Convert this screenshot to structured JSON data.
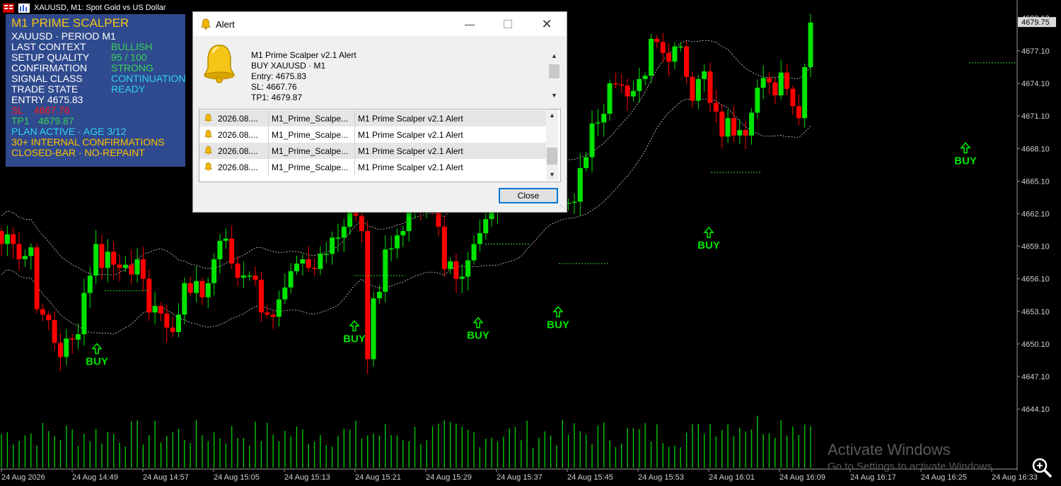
{
  "window": {
    "title": "XAUUSD, M1:  Spot Gold vs US Dollar",
    "current_price_tag": "4679.75",
    "top_price_label": "4680.13"
  },
  "panel": {
    "title": "M1 PRIME SCALPER",
    "subtitle": "XAUUSD · PERIOD M1",
    "rows": [
      {
        "label": "LAST CONTEXT",
        "value": "BULLISH"
      },
      {
        "label": "SETUP QUALITY",
        "value": "95 / 100"
      },
      {
        "label": "CONFIRMATION",
        "value": "STRONG"
      },
      {
        "label": "SIGNAL CLASS",
        "value": "CONTINUATION"
      },
      {
        "label": "TRADE STATE",
        "value": "READY"
      }
    ],
    "entry": "ENTRY 4675.83",
    "sl_label": "SL",
    "sl_value": "4667.76",
    "tp_label": "TP1",
    "tp_value": "4679.87",
    "plan": "PLAN ACTIVE · AGE 3/12",
    "confirmations": "30+ INTERNAL CONFIRMATIONS",
    "closed_bar": "CLOSED-BAR · NO-REPAINT",
    "colors": {
      "bg": "#2f4a8e",
      "title": "#f5c518",
      "green": "#39d353",
      "cyan": "#2fd4f0",
      "red": "#ff1a1a",
      "orange": "#ffc000"
    }
  },
  "alert": {
    "title": "Alert",
    "message": [
      "M1 Prime Scalper v2.1 Alert",
      "BUY XAUUSD · M1",
      "Entry: 4675.83",
      "SL: 4667.76",
      "TP1: 4679.87"
    ],
    "rows": [
      {
        "date": "2026.08....",
        "expert": "M1_Prime_Scalpe...",
        "text": "M1 Prime Scalper v2.1 Alert"
      },
      {
        "date": "2026.08....",
        "expert": "M1_Prime_Scalpe...",
        "text": "M1 Prime Scalper v2.1 Alert"
      },
      {
        "date": "2026.08....",
        "expert": "M1_Prime_Scalpe...",
        "text": "M1 Prime Scalper v2.1 Alert"
      },
      {
        "date": "2026.08....",
        "expert": "M1_Prime_Scalpe...",
        "text": "M1 Prime Scalper v2.1 Alert"
      }
    ],
    "close_label": "Close"
  },
  "chart_data": {
    "type": "candlestick",
    "symbol": "XAUUSD",
    "timeframe": "M1",
    "ylim": [
      4641.7,
      4681.0
    ],
    "y_ticks": [
      "4677.10",
      "4674.10",
      "4671.10",
      "4668.10",
      "4665.10",
      "4662.10",
      "4659.10",
      "4656.10",
      "4653.10",
      "4650.10",
      "4647.10",
      "4644.10"
    ],
    "x_ticks": [
      "24 Aug 2026",
      "24 Aug 14:49",
      "24 Aug 14:57",
      "24 Aug 15:05",
      "24 Aug 15:13",
      "24 Aug 15:21",
      "24 Aug 15:29",
      "24 Aug 15:37",
      "24 Aug 15:45",
      "24 Aug 15:53",
      "24 Aug 16:01",
      "24 Aug 16:09",
      "24 Aug 16:17",
      "24 Aug 16:25",
      "24 Aug 16:33"
    ],
    "closes": [
      4659.3,
      4660.2,
      4659.3,
      4657.9,
      4658.2,
      4659.0,
      4653.3,
      4652.8,
      4652.3,
      4650.2,
      4648.9,
      4650.6,
      4650.5,
      4651.0,
      4654.8,
      4656.4,
      4659.3,
      4657.1,
      4658.6,
      4657.4,
      4657.1,
      4657.4,
      4656.5,
      4657.9,
      4656.1,
      4653.0,
      4653.6,
      4652.9,
      4651.6,
      4651.2,
      4652.8,
      4655.7,
      4654.8,
      4655.9,
      4654.4,
      4655.7,
      4657.9,
      4659.6,
      4659.8,
      4657.5,
      4656.2,
      4656.4,
      4656.4,
      4656.0,
      4653.0,
      4652.8,
      4652.6,
      4654.2,
      4655.3,
      4656.8,
      4657.5,
      4657.9,
      4657.1,
      4657.0,
      4658.4,
      4658.4,
      4659.9,
      4659.9,
      4660.9,
      4662.7,
      4661.9,
      4660.5,
      4648.7,
      4654.3,
      4654.9,
      4658.8,
      4658.9,
      4660.1,
      4660.5,
      4662.3,
      4663.6,
      4662.4,
      4663.3,
      4663.1,
      4660.9,
      4657.0,
      4657.7,
      4656.1,
      4656.3,
      4657.8,
      4659.3,
      4660.3,
      4661.6,
      4662.5,
      4663.8,
      4665.1,
      4665.3,
      4665.5,
      4665.1,
      4666.4,
      4665.8,
      4664.9,
      4664.7,
      4664.1,
      4663.2,
      4663.0,
      4663.1,
      4663.2,
      4666.3,
      4667.3,
      4670.4,
      4670.5,
      4671.3,
      4674.1,
      4674.0,
      4673.9,
      4672.9,
      4673.4,
      4674.5,
      4674.8,
      4678.2,
      4677.9,
      4676.9,
      4676.1,
      4677.5,
      4677.5,
      4674.7,
      4672.5,
      4674.5,
      4675.2,
      4672.3,
      4671.5,
      4669.2,
      4670.9,
      4669.3,
      4669.8,
      4669.3,
      4671.4,
      4673.7,
      4674.6,
      4674.2,
      4673.0,
      4675.1,
      4673.6,
      4672.0,
      4670.9,
      4675.6,
      4679.7
    ],
    "signals": [
      {
        "label": "BUY"
      },
      {
        "label": "BUY"
      },
      {
        "label": "BUY"
      },
      {
        "label": "BUY"
      },
      {
        "label": "BUY"
      },
      {
        "label": "BUY"
      }
    ],
    "colors": {
      "bull": "#00e400",
      "bear": "#ff0000",
      "band": "#ffffff",
      "volume": "#00c800",
      "buy": "#00e400"
    }
  },
  "watermark": {
    "line1": "Activate Windows",
    "line2": "Go to Settings to activate Windows."
  }
}
